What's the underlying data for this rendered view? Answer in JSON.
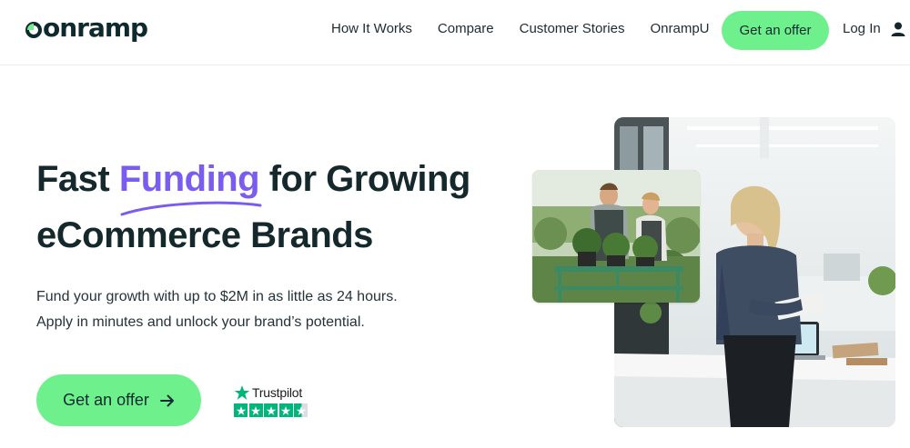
{
  "brand": {
    "name": "onramp",
    "accent": "#6ef18d",
    "highlight": "#7b5cf0",
    "dark": "#15292d"
  },
  "nav": {
    "items": [
      {
        "label": "How It Works"
      },
      {
        "label": "Compare"
      },
      {
        "label": "Customer Stories"
      },
      {
        "label": "OnrampU"
      }
    ],
    "cta_label": "Get an offer",
    "login_label": "Log In",
    "login_icon": "user-icon"
  },
  "hero": {
    "title_prefix": "Fast",
    "title_highlight": "Funding",
    "title_suffix": "for Growing",
    "title_line2": "eCommerce Brands",
    "subtext_line1": "Fund your growth with up to $2M in as little as 24 hours.",
    "subtext_line2": "Apply in minutes and unlock your brand’s potential.",
    "cta_label": "Get an offer",
    "cta_icon": "arrow-right-icon"
  },
  "trustpilot": {
    "label": "Trustpilot",
    "rating_stars": 4.5,
    "max_stars": 5,
    "color": "#00b67a"
  }
}
